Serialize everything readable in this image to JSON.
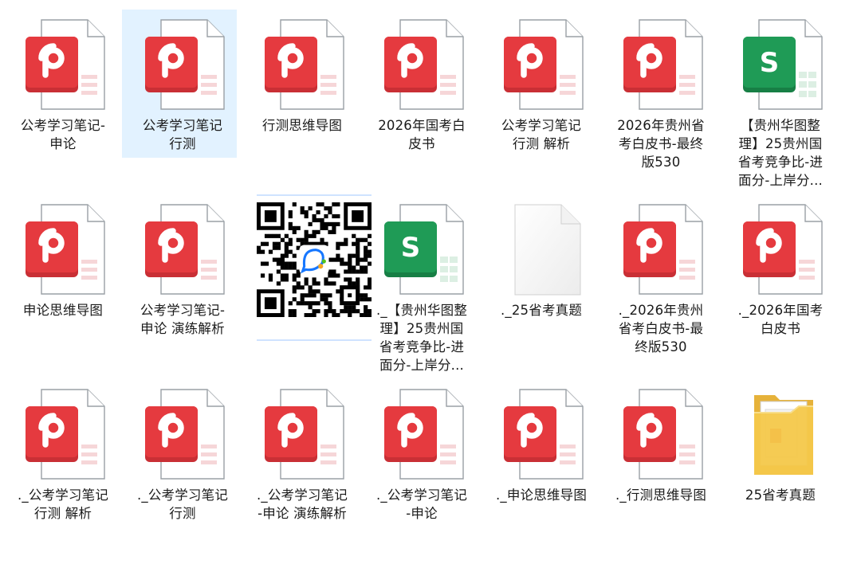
{
  "window": {
    "title": ""
  },
  "colors": {
    "pdf_red": "#e53a3f",
    "pdf_red_dark": "#c92f35",
    "sheet_green": "#1f9b56",
    "sheet_green_dark": "#177f45",
    "selection": "#cce8ff",
    "folder_yellow": "#f4c84a"
  },
  "files": [
    {
      "name": "公考学习笔记-\n申论",
      "type": "pdf-icon"
    },
    {
      "name": "公考学习笔记\n行测",
      "type": "pdf-icon",
      "selected": true
    },
    {
      "name": "行测思维导图",
      "type": "pdf-icon"
    },
    {
      "name": "2026年国考白\n皮书",
      "type": "pdf-icon"
    },
    {
      "name": "公考学习笔记\n行测 解析",
      "type": "pdf-icon"
    },
    {
      "name": "2026年贵州省\n考白皮书-最终\n版530",
      "type": "pdf-icon"
    },
    {
      "name": "【贵州华图整\n理】25贵州国\n省考竞争比-进\n面分-上岸分...",
      "type": "sheet-icon"
    },
    {
      "name": "申论思维导图",
      "type": "pdf-icon"
    },
    {
      "name": "公考学习笔记-\n申论 演练解析",
      "type": "pdf-icon"
    },
    {
      "name": "",
      "type": "qr-code"
    },
    {
      "name": "._【贵州华图整\n理】25贵州国\n省考竞争比-进\n面分-上岸分...",
      "type": "sheet-icon"
    },
    {
      "name": "._25省考真题",
      "type": "blank-file-icon"
    },
    {
      "name": "._2026年贵州\n省考白皮书-最\n终版530",
      "type": "pdf-icon"
    },
    {
      "name": "._2026年国考\n白皮书",
      "type": "pdf-icon"
    },
    {
      "name": "._公考学习笔记\n行测 解析",
      "type": "pdf-icon"
    },
    {
      "name": "._公考学习笔记\n行测",
      "type": "pdf-icon"
    },
    {
      "name": "._公考学习笔记\n-申论 演练解析",
      "type": "pdf-icon"
    },
    {
      "name": "._公考学习笔记\n-申论",
      "type": "pdf-icon"
    },
    {
      "name": "._申论思维导图",
      "type": "pdf-icon"
    },
    {
      "name": "._行测思维导图",
      "type": "pdf-icon"
    },
    {
      "name": "25省考真题",
      "type": "folder-icon"
    }
  ]
}
